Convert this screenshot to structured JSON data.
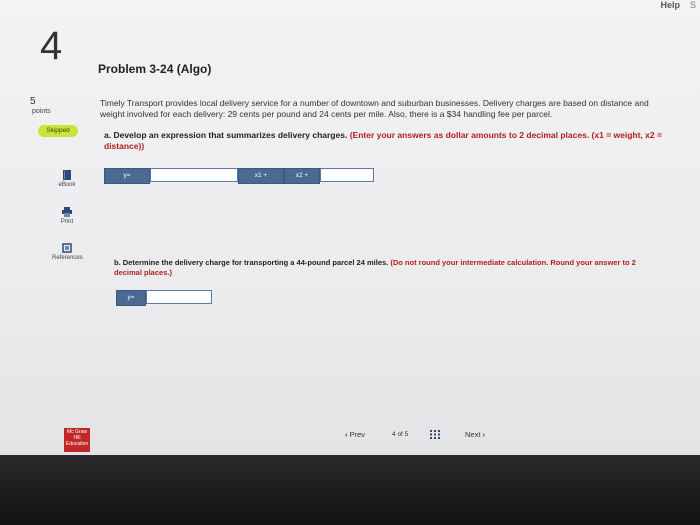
{
  "header": {
    "help_label": "Help",
    "edge_label": "S"
  },
  "question": {
    "number": "4",
    "title": "Problem 3-24 (Algo)",
    "points_value": "5",
    "points_label": "points",
    "status_badge": "Skipped"
  },
  "problem_text": "Timely Transport provides local delivery service for a number of downtown and suburban businesses. Delivery charges are based on distance and weight involved for each delivery: 29 cents per pound and 24 cents per mile. Also, there is a $34 handling fee per parcel.",
  "part_a": {
    "text": "a. Develop an expression that summarizes delivery charges.",
    "requirement": "(Enter your answers as dollar amounts to 2 decimal places. (x1 = weight, x2 = distance))",
    "y_label": "y=",
    "x1_label": "x1 +",
    "x2_label": "x2 +",
    "y_value": "",
    "x1_value": "",
    "x2_value": ""
  },
  "part_b": {
    "text": "b. Determine the delivery charge for transporting a 44-pound parcel 24 miles.",
    "requirement": "(Do not round your intermediate calculation. Round your answer to 2 decimal places.)",
    "y_label": "y=",
    "y_value": ""
  },
  "tools": [
    {
      "label": "eBook",
      "icon": "book-icon"
    },
    {
      "label": "Print",
      "icon": "printer-icon"
    },
    {
      "label": "References",
      "icon": "references-icon"
    }
  ],
  "navigation": {
    "prev_label": "Prev",
    "current": "4",
    "of_label": "of",
    "total": "5",
    "next_label": "Next"
  },
  "logo": {
    "text": "Mc Graw Hill Education"
  },
  "colors": {
    "badge": "#c9e53a",
    "accent": "#4a6a94",
    "nav_chevron": "#a01818",
    "logo": "#c02828"
  }
}
